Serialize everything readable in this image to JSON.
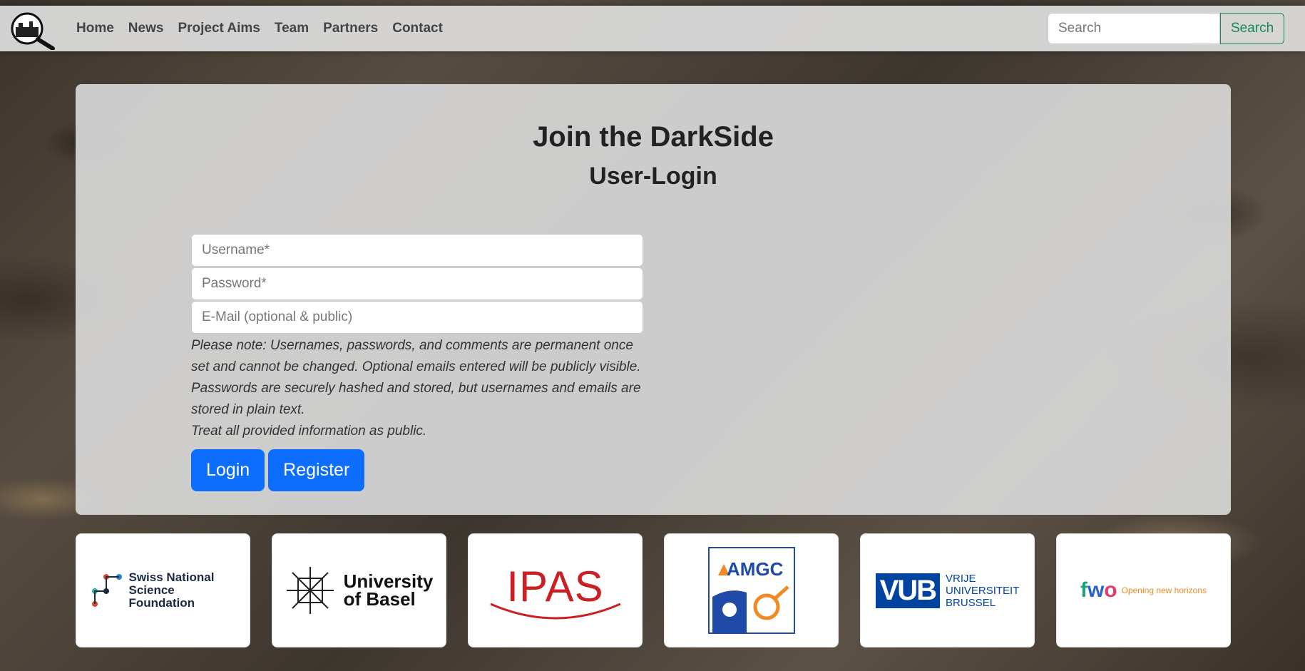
{
  "navbar": {
    "links": [
      "Home",
      "News",
      "Project Aims",
      "Team",
      "Partners",
      "Contact"
    ],
    "search_placeholder": "Search",
    "search_button": "Search"
  },
  "login": {
    "title": "Join the DarkSide",
    "subtitle": "User-Login",
    "username_placeholder": "Username*",
    "password_placeholder": "Password*",
    "email_placeholder": "E-Mail (optional & public)",
    "note_line1": "Please note: Usernames, passwords, and comments are permanent once set and cannot be changed. Optional emails entered will be publicly visible. Passwords are securely hashed and stored, but usernames and emails are stored in plain text.",
    "note_line2": "Treat all provided information as public.",
    "login_button": "Login",
    "register_button": "Register"
  },
  "partners": {
    "snsf": "Swiss National Science Foundation",
    "basel_line1": "University",
    "basel_line2": "of Basel",
    "ipas": "IPAS",
    "amgc": "AMGC",
    "vub_mark": "VUB",
    "vub_line1": "VRIJE",
    "vub_line2": "UNIVERSITEIT",
    "vub_line3": "BRUSSEL",
    "fwo_mark": "fwo",
    "fwo_tagline": "Opening new horizons"
  }
}
